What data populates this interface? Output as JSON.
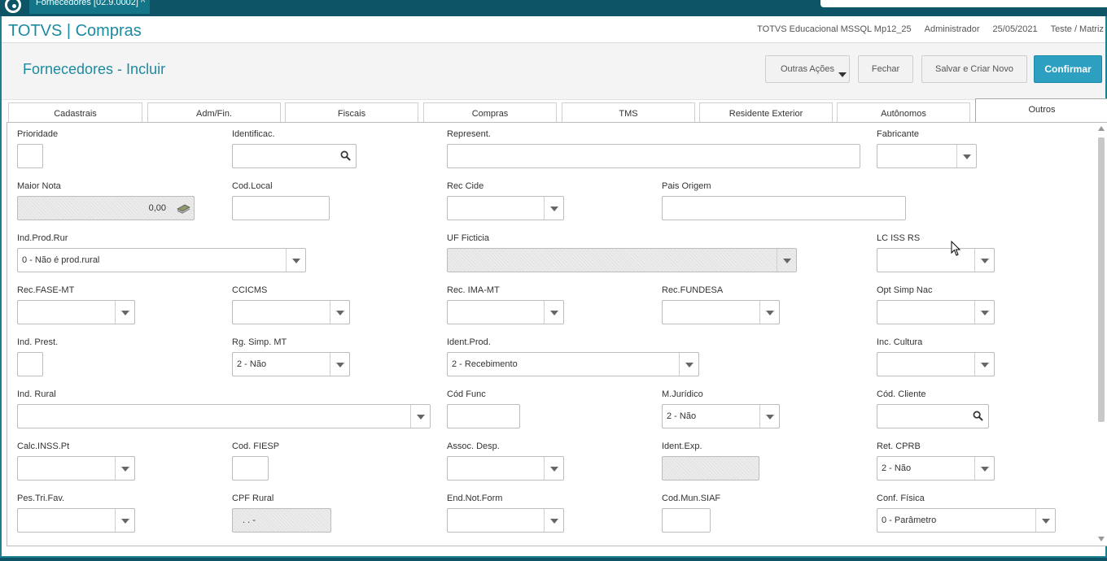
{
  "window": {
    "tab_label": "Fornecedores [02.9.0002]",
    "tab_close": "^"
  },
  "header": {
    "app_title": "TOTVS | Compras",
    "environment": "TOTVS Educacional MSSQL Mp12_25",
    "user": "Administrador",
    "date": "25/05/2021",
    "branch": "Teste / Matriz"
  },
  "page": {
    "title": "Fornecedores - Incluir"
  },
  "actions": {
    "more": "Outras Ações",
    "close": "Fechar",
    "save_new": "Salvar e Criar Novo",
    "confirm": "Confirmar"
  },
  "tabs": [
    "Cadastrais",
    "Adm/Fin.",
    "Fiscais",
    "Compras",
    "TMS",
    "Residente Exterior",
    "Autônomos",
    "Outros"
  ],
  "active_tab": "Outros",
  "form": {
    "prioridade": {
      "label": "Prioridade",
      "value": ""
    },
    "identificac": {
      "label": "Identificac.",
      "value": ""
    },
    "represent": {
      "label": "Represent.",
      "value": ""
    },
    "fabricante": {
      "label": "Fabricante",
      "value": ""
    },
    "maior_nota": {
      "label": "Maior Nota",
      "value": "0,00"
    },
    "cod_local": {
      "label": "Cod.Local",
      "value": ""
    },
    "rec_cide": {
      "label": "Rec Cide",
      "value": ""
    },
    "pais_origem": {
      "label": "Pais Origem",
      "value": ""
    },
    "ind_prod_rur": {
      "label": "Ind.Prod.Rur",
      "value": "0 - Não é prod.rural"
    },
    "uf_ficticia": {
      "label": "UF Ficticia",
      "value": ""
    },
    "lc_iss_rs": {
      "label": "LC ISS RS",
      "value": ""
    },
    "rec_fase_mt": {
      "label": "Rec.FASE-MT",
      "value": ""
    },
    "ccicms": {
      "label": "CCICMS",
      "value": ""
    },
    "rec_ima_mt": {
      "label": "Rec. IMA-MT",
      "value": ""
    },
    "rec_fundesa": {
      "label": "Rec.FUNDESA",
      "value": ""
    },
    "opt_simp_nac": {
      "label": "Opt Simp Nac",
      "value": ""
    },
    "ind_prest": {
      "label": "Ind. Prest.",
      "value": ""
    },
    "rg_simp_mt": {
      "label": "Rg. Simp. MT",
      "value": "2 - Não"
    },
    "ident_prod": {
      "label": "Ident.Prod.",
      "value": "2 - Recebimento"
    },
    "inc_cultura": {
      "label": "Inc. Cultura",
      "value": ""
    },
    "ind_rural": {
      "label": "Ind. Rural",
      "value": ""
    },
    "cod_func": {
      "label": "Cód Func",
      "value": ""
    },
    "m_juridico": {
      "label": "M.Jurídico",
      "value": "2 - Não"
    },
    "cod_cliente": {
      "label": "Cód. Cliente",
      "value": ""
    },
    "calc_inss_pt": {
      "label": "Calc.INSS.Pt",
      "value": ""
    },
    "cod_fiesp": {
      "label": "Cod. FIESP",
      "value": ""
    },
    "assoc_desp": {
      "label": "Assoc. Desp.",
      "value": ""
    },
    "ident_exp": {
      "label": "Ident.Exp.",
      "value": ""
    },
    "ret_cprb": {
      "label": "Ret. CPRB",
      "value": "2 - Não"
    },
    "pes_tri_fav": {
      "label": "Pes.Tri.Fav.",
      "value": ""
    },
    "cpf_rural": {
      "label": "CPF Rural",
      "value": ". . -"
    },
    "end_not_form": {
      "label": "End.Not.Form",
      "value": ""
    },
    "cod_mun_siaf": {
      "label": "Cod.Mun.SIAF",
      "value": ""
    },
    "conf_fisica": {
      "label": "Conf. Física",
      "value": "0 - Parâmetro"
    }
  },
  "colors": {
    "brand": "#1c8aa0",
    "frame": "#0d5566",
    "confirm": "#2d9fc1"
  }
}
